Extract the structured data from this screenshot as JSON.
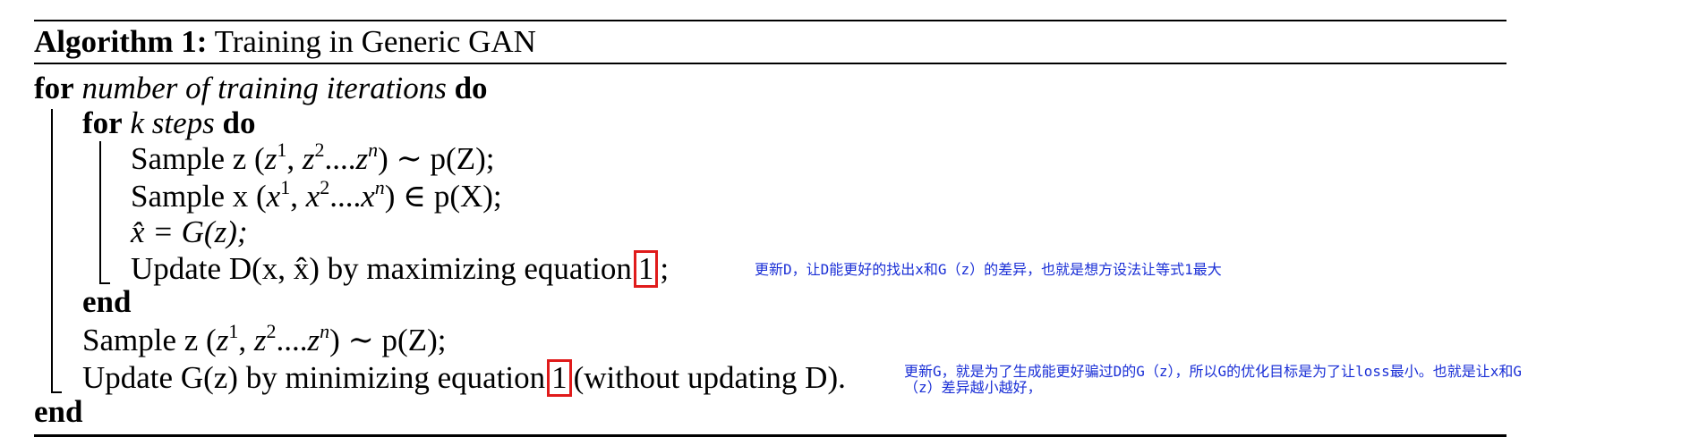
{
  "algorithm": {
    "caption_label": "Algorithm 1:",
    "caption_title": "Training in Generic GAN",
    "outer_for_kw": "for",
    "outer_for_cond": "number of training iterations",
    "outer_do_kw": "do",
    "inner_for_kw": "for",
    "inner_for_var": "k",
    "inner_for_cond": "steps",
    "inner_do_kw": "do",
    "inner_lines": [
      "Sample z (",
      "Sample x (",
      "x̂ = G(z);",
      "Update D(x, x̂) by maximizing equation"
    ],
    "sample_z_tail": ") ∼ p(Z);",
    "sample_x_tail": ") ∈ p(X);",
    "eq_ref_1": "1",
    "eq_ref_1_tail": ";",
    "inner_end_kw": "end",
    "outer_lines": [
      "Sample z (",
      "Update G(z) by minimizing equation"
    ],
    "eq_ref_2": "1",
    "update_g_tail": "(without updating D).",
    "outer_end_kw": "end"
  },
  "annotations": {
    "note_d": "更新D，让D能更好的找出x和G（z）的差异，也就是想方设法让等式1最大",
    "note_g_line1": "更新G，就是为了生成能更好骗过D的G（z），所以G的优化目标是为了让loss最小。也就是让x和G",
    "note_g_line2": "（z）差异越小越好，"
  },
  "colors": {
    "annotation_text": "#1a2fd6",
    "ref_box": "#e01b1b"
  }
}
